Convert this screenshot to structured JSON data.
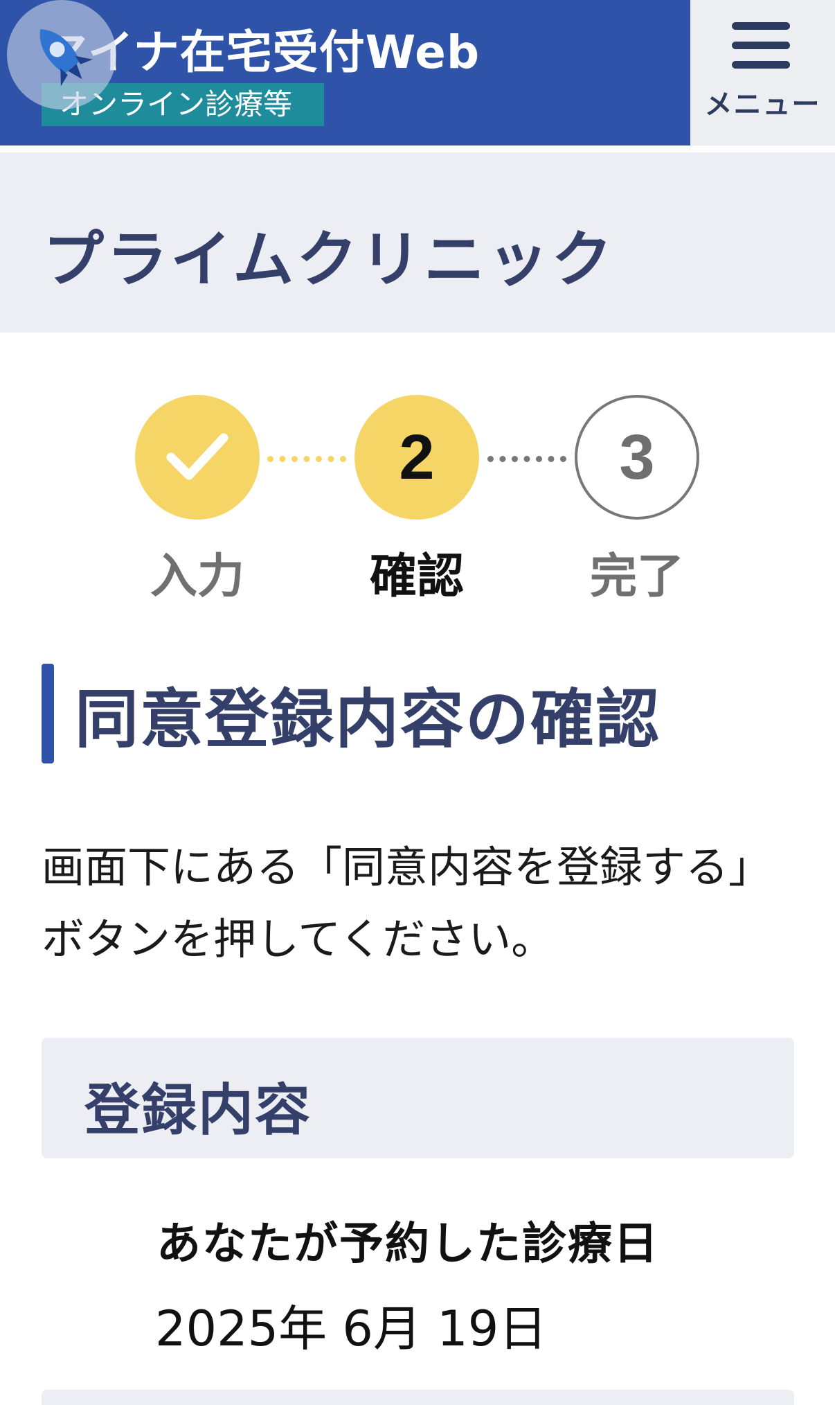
{
  "header": {
    "app_title": "マイナ在宅受付Web",
    "badge": "オンライン診療等",
    "menu_label": "メニュー"
  },
  "clinic": {
    "name": "プライムクリニック"
  },
  "stepper": {
    "steps": [
      {
        "label": "入力",
        "number": "1",
        "state": "done"
      },
      {
        "label": "確認",
        "number": "2",
        "state": "current"
      },
      {
        "label": "完了",
        "number": "3",
        "state": "upcoming"
      }
    ]
  },
  "section": {
    "title": "同意登録内容の確認",
    "instructions": "画面下にある「同意内容を登録する」ボタンを押してください。"
  },
  "registration": {
    "panel_title": "登録内容",
    "fields": [
      {
        "label": "あなたが予約した診療日",
        "value": "2025年 6月 19日"
      }
    ]
  },
  "colors": {
    "brand_blue": "#2f53a8",
    "badge_teal": "#1e8c9b",
    "heading_navy": "#34406a",
    "step_yellow": "#f6d567",
    "band_gray": "#eceef3"
  },
  "icons": {
    "logo": "rocket-logo-icon",
    "menu": "hamburger-menu-icon",
    "step_done": "check-icon"
  }
}
